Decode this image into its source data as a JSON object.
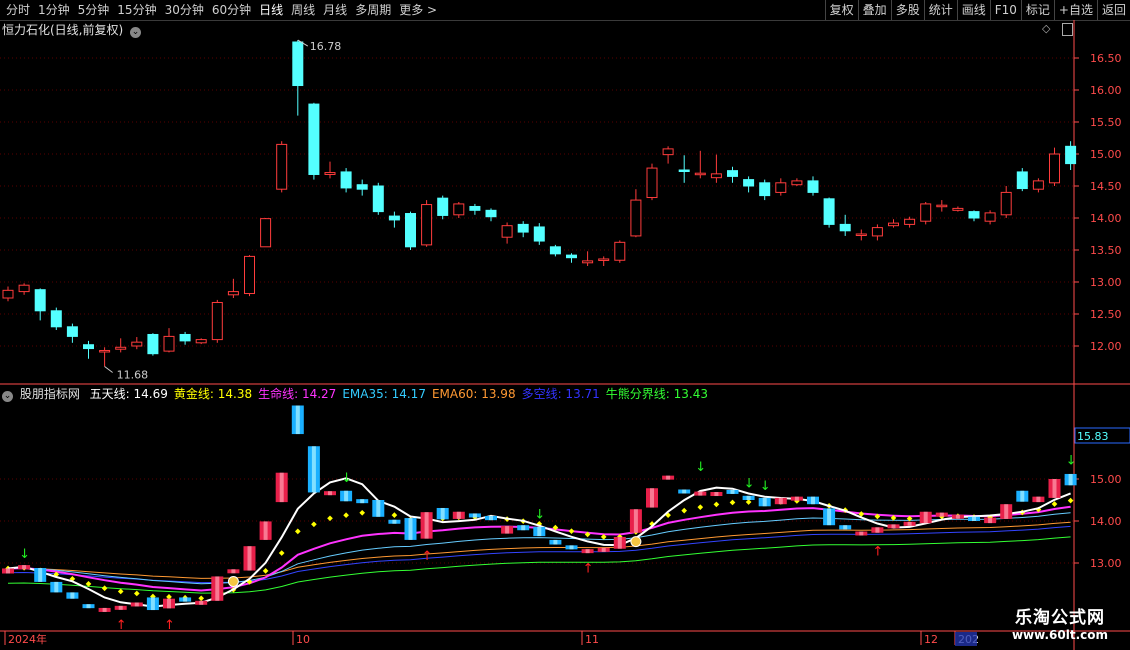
{
  "toolbar": {
    "periods": [
      "分时",
      "1分钟",
      "5分钟",
      "15分钟",
      "30分钟",
      "60分钟",
      "日线",
      "周线",
      "月线",
      "多周期",
      "更多 >"
    ],
    "active_period": "日线",
    "actions": [
      "复权",
      "叠加",
      "多股",
      "统计",
      "画线",
      "F10",
      "标记",
      "+自选",
      "返回"
    ]
  },
  "main_chart": {
    "title": "恒力石化(日线,前复权)",
    "y_ticks": [
      "16.50",
      "16.00",
      "15.50",
      "15.00",
      "14.50",
      "14.00",
      "13.50",
      "13.00",
      "12.50",
      "12.00"
    ],
    "high_label": "16.78",
    "low_label": "11.68"
  },
  "indicator": {
    "name": "股朋指标网",
    "values": [
      {
        "label": "五天线:",
        "value": "14.69",
        "color": "#ffffff"
      },
      {
        "label": "黄金线:",
        "value": "14.38",
        "color": "#ffff00"
      },
      {
        "label": "生命线:",
        "value": "14.27",
        "color": "#ff33ff"
      },
      {
        "label": "EMA35:",
        "value": "14.17",
        "color": "#33ccff"
      },
      {
        "label": "EMA60:",
        "value": "13.98",
        "color": "#ff9933"
      },
      {
        "label": "多空线:",
        "value": "13.71",
        "color": "#3333ff"
      },
      {
        "label": "牛熊分界线:",
        "value": "13.43",
        "color": "#33ff33"
      }
    ],
    "y_ticks": [
      "15.00",
      "14.00",
      "13.00"
    ],
    "current_label": "15.83"
  },
  "x_axis": {
    "labels": [
      "2024年",
      "10",
      "11",
      "12",
      "202"
    ]
  },
  "watermark": {
    "line1": "乐淘公式网",
    "line2": "www.60lt.com"
  },
  "colors": {
    "up": "#ff3c3c",
    "down": "#54ffff",
    "axis": "#ff4b4b",
    "grid": "#5a0000"
  },
  "chart_data": {
    "type": "candlestick",
    "candles": [
      [
        12.75,
        12.87,
        12.7,
        12.93
      ],
      [
        12.85,
        12.95,
        12.8,
        12.98
      ],
      [
        12.88,
        12.55,
        12.4,
        12.9
      ],
      [
        12.55,
        12.3,
        12.25,
        12.6
      ],
      [
        12.3,
        12.15,
        12.05,
        12.35
      ],
      [
        12.02,
        11.96,
        11.8,
        12.08
      ],
      [
        11.92,
        11.93,
        11.68,
        11.98
      ],
      [
        11.95,
        11.98,
        11.9,
        12.12
      ],
      [
        12.0,
        12.06,
        11.95,
        12.14
      ],
      [
        12.18,
        11.88,
        11.85,
        12.2
      ],
      [
        11.92,
        12.15,
        11.9,
        12.28
      ],
      [
        12.18,
        12.08,
        12.02,
        12.22
      ],
      [
        12.05,
        12.1,
        12.03,
        12.12
      ],
      [
        12.1,
        12.68,
        12.05,
        12.72
      ],
      [
        12.8,
        12.85,
        12.75,
        13.05
      ],
      [
        12.82,
        13.4,
        12.78,
        13.42
      ],
      [
        13.55,
        13.99,
        13.55,
        14.0
      ],
      [
        14.45,
        15.15,
        14.4,
        15.2
      ],
      [
        16.75,
        16.07,
        15.6,
        16.78
      ],
      [
        15.78,
        14.68,
        14.6,
        15.8
      ],
      [
        14.68,
        14.71,
        14.62,
        14.88
      ],
      [
        14.72,
        14.47,
        14.4,
        14.78
      ],
      [
        14.52,
        14.45,
        14.35,
        14.6
      ],
      [
        14.5,
        14.1,
        14.05,
        14.55
      ],
      [
        14.03,
        13.97,
        13.85,
        14.1
      ],
      [
        14.07,
        13.55,
        13.5,
        14.1
      ],
      [
        13.58,
        14.21,
        13.55,
        14.28
      ],
      [
        14.31,
        14.04,
        13.98,
        14.35
      ],
      [
        14.05,
        14.22,
        14.0,
        14.25
      ],
      [
        14.18,
        14.12,
        14.05,
        14.22
      ],
      [
        14.12,
        14.02,
        13.95,
        14.15
      ],
      [
        13.7,
        13.88,
        13.6,
        13.93
      ],
      [
        13.9,
        13.78,
        13.7,
        13.95
      ],
      [
        13.86,
        13.64,
        13.58,
        13.92
      ],
      [
        13.55,
        13.44,
        13.4,
        13.58
      ],
      [
        13.42,
        13.38,
        13.3,
        13.45
      ],
      [
        13.3,
        13.33,
        13.25,
        13.48
      ],
      [
        13.35,
        13.36,
        13.25,
        13.4
      ],
      [
        13.34,
        13.62,
        13.3,
        13.65
      ],
      [
        13.72,
        14.28,
        13.7,
        14.45
      ],
      [
        14.32,
        14.78,
        14.28,
        14.85
      ],
      [
        14.99,
        15.08,
        14.85,
        15.12
      ],
      [
        14.75,
        14.73,
        14.55,
        14.98
      ],
      [
        14.7,
        14.7,
        14.62,
        15.05
      ],
      [
        14.63,
        14.69,
        14.55,
        14.99
      ],
      [
        14.74,
        14.65,
        14.55,
        14.8
      ],
      [
        14.6,
        14.5,
        14.4,
        14.65
      ],
      [
        14.55,
        14.35,
        14.28,
        14.6
      ],
      [
        14.4,
        14.55,
        14.35,
        14.62
      ],
      [
        14.52,
        14.58,
        14.5,
        14.62
      ],
      [
        14.58,
        14.4,
        14.35,
        14.65
      ],
      [
        14.3,
        13.9,
        13.85,
        14.32
      ],
      [
        13.9,
        13.8,
        13.72,
        14.05
      ],
      [
        13.75,
        13.75,
        13.65,
        13.82
      ],
      [
        13.72,
        13.85,
        13.65,
        13.9
      ],
      [
        13.88,
        13.92,
        13.85,
        13.98
      ],
      [
        13.9,
        13.98,
        13.85,
        14.02
      ],
      [
        13.95,
        14.22,
        13.9,
        14.25
      ],
      [
        14.18,
        14.2,
        14.1,
        14.28
      ],
      [
        14.12,
        14.15,
        14.1,
        14.18
      ],
      [
        14.1,
        14.0,
        13.95,
        14.12
      ],
      [
        13.95,
        14.08,
        13.9,
        14.12
      ],
      [
        14.05,
        14.4,
        14.0,
        14.5
      ],
      [
        14.72,
        14.46,
        14.42,
        14.78
      ],
      [
        14.45,
        14.58,
        14.4,
        14.62
      ],
      [
        14.55,
        15.0,
        14.5,
        15.1
      ],
      [
        15.12,
        14.85,
        14.75,
        15.2
      ]
    ],
    "y_range": [
      11.5,
      16.9
    ]
  }
}
